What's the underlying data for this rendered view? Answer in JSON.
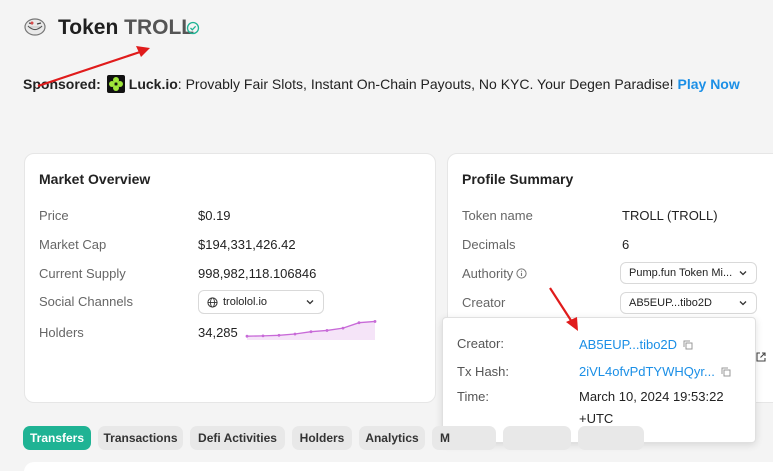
{
  "header": {
    "token_prefix": "Token",
    "token_symbol": "TROLL",
    "logo_icon": "troll-face-icon",
    "verified_icon": "check-circle-icon",
    "verified_color": "#1fb394"
  },
  "sponsor": {
    "label": "Sponsored:",
    "brand": "Luck.io",
    "text": ": Provably Fair Slots, Instant On-Chain Payouts, No KYC. Your Degen Paradise!",
    "cta": "Play Now",
    "cta_color": "#1b8fe6"
  },
  "market": {
    "title": "Market Overview",
    "price_label": "Price",
    "price_value": "$0.19",
    "mcap_label": "Market Cap",
    "mcap_value": "$194,331,426.42",
    "supply_label": "Current Supply",
    "supply_value": "998,982,118.106846",
    "social_label": "Social Channels",
    "social_value": "trololol.io",
    "holders_label": "Holders",
    "holders_value": "34,285",
    "holders_trend": [
      0.1,
      0.12,
      0.15,
      0.22,
      0.35,
      0.42,
      0.55,
      0.85,
      0.92
    ],
    "sparkline_color": "#c86ad8"
  },
  "profile": {
    "title": "Profile Summary",
    "name_label": "Token name",
    "name_value": "TROLL (TROLL)",
    "decimals_label": "Decimals",
    "decimals_value": "6",
    "authority_label": "Authority",
    "authority_value": "Pump.fun Token Mi...",
    "creator_label": "Creator",
    "creator_value": "AB5EUP...tibo2D"
  },
  "popup": {
    "creator_label": "Creator:",
    "creator_value": "AB5EUP...tibo2D",
    "tx_label": "Tx Hash:",
    "tx_value": "2iVL4ofvPdTYWHQyr...",
    "time_label": "Time:",
    "time_value_line1": "March 10, 2024 19:53:22",
    "time_value_line2": "+UTC"
  },
  "tabs": [
    {
      "label": "Transfers",
      "active": true
    },
    {
      "label": "Transactions",
      "active": false
    },
    {
      "label": "Defi Activities",
      "active": false
    },
    {
      "label": "Holders",
      "active": false
    },
    {
      "label": "Analytics",
      "active": false
    },
    {
      "label": "M",
      "active": false
    },
    {
      "label": "",
      "active": false
    },
    {
      "label": "",
      "active": false
    }
  ],
  "annotation_color": "#e01b1b"
}
